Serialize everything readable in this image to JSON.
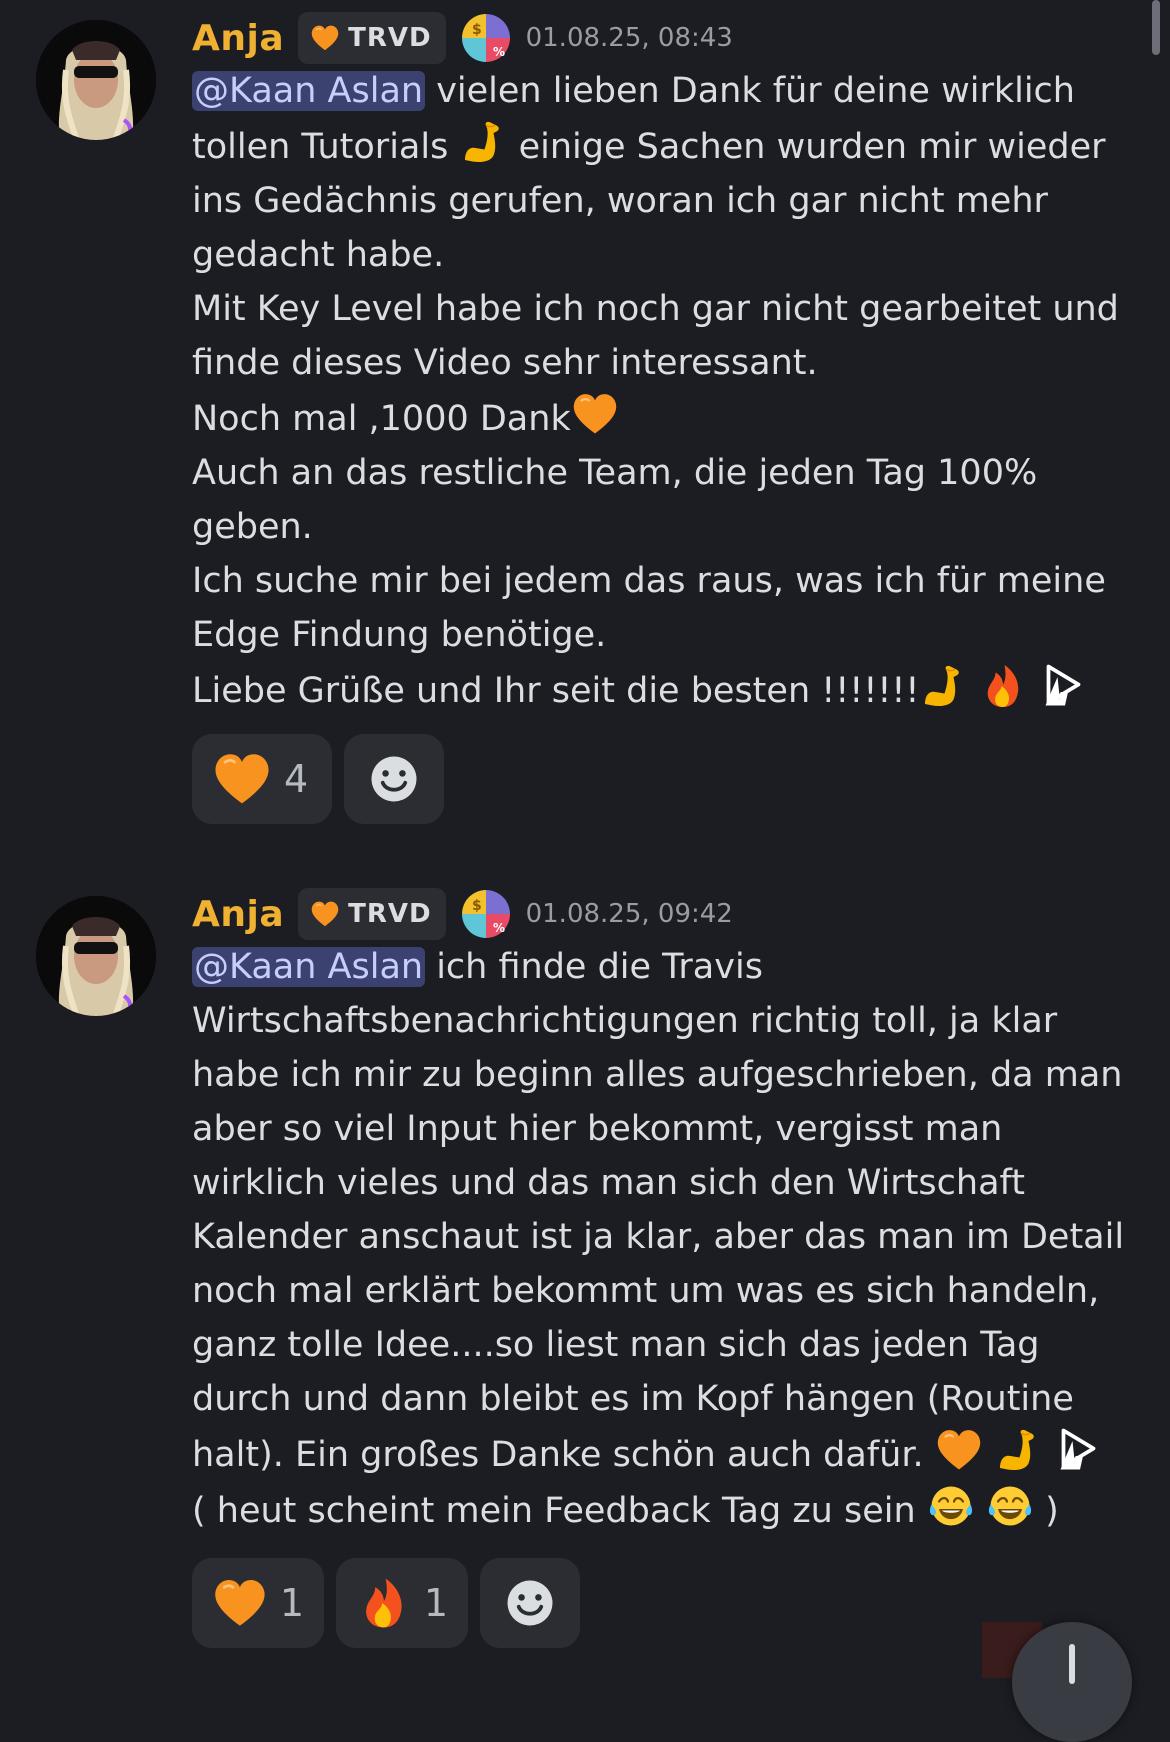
{
  "messages": [
    {
      "author": "Anja",
      "tag": "TRVD",
      "timestamp": "01.08.25, 08:43",
      "mention": "@Kaan Aslan",
      "lines": [
        " vielen lieben Dank für deine wirklich",
        "tollen Tutorials ",
        " einige Sachen wurden mir wieder",
        "ins Gedächnis gerufen, woran ich gar nicht mehr",
        "gedacht habe.",
        "Mit Key Level habe ich noch gar nicht gearbeitet und",
        "finde dieses Video sehr interessant.",
        "Noch mal ,1000 Dank",
        "Auch an das restliche Team, die jeden Tag 100%",
        "geben.",
        "Ich suche mir bei jedem das raus, was ich für meine",
        "Edge Findung benötige.",
        "Liebe Grüße und Ihr seit die besten !!!!!!!"
      ],
      "reactions": [
        {
          "emoji": "orange-heart",
          "count": "4"
        }
      ]
    },
    {
      "author": "Anja",
      "tag": "TRVD",
      "timestamp": "01.08.25, 09:42",
      "mention": "@Kaan Aslan",
      "lines": [
        " ich finde die Travis",
        "Wirtschaftsbenachrichtigungen richtig toll, ja klar",
        "habe ich mir zu beginn alles aufgeschrieben, da man",
        "aber so viel Input hier bekommt, vergisst man",
        "wirklich vieles und das man sich den Wirtschaft",
        "Kalender anschaut ist ja klar, aber das man im Detail",
        "noch mal erklärt bekommt um was es sich handeln,",
        "ganz tolle Idee....so liest man sich das jeden Tag",
        "durch und dann bleibt es im Kopf hängen (Routine",
        "halt).  Ein großes Danke schön auch dafür. ",
        "( heut scheint mein Feedback Tag zu sein ",
        " )"
      ],
      "reactions": [
        {
          "emoji": "orange-heart",
          "count": "1"
        },
        {
          "emoji": "fire",
          "count": "1"
        }
      ]
    }
  ],
  "colors": {
    "background": "#1c1d23",
    "username": "#f0b132",
    "mention_bg": "#3c4270",
    "mention_text": "#c9cdfb",
    "text": "#dbdee1",
    "timestamp": "#9a9ca5",
    "pill": "#2b2d33"
  },
  "icons": [
    "avatar-photo",
    "orange-heart-icon",
    "role-coin-icon",
    "flexed-biceps-icon",
    "fire-icon",
    "custom-play-emote-icon",
    "tears-of-joy-icon",
    "smiley-add-reaction-icon",
    "jump-down-arrow-icon"
  ]
}
